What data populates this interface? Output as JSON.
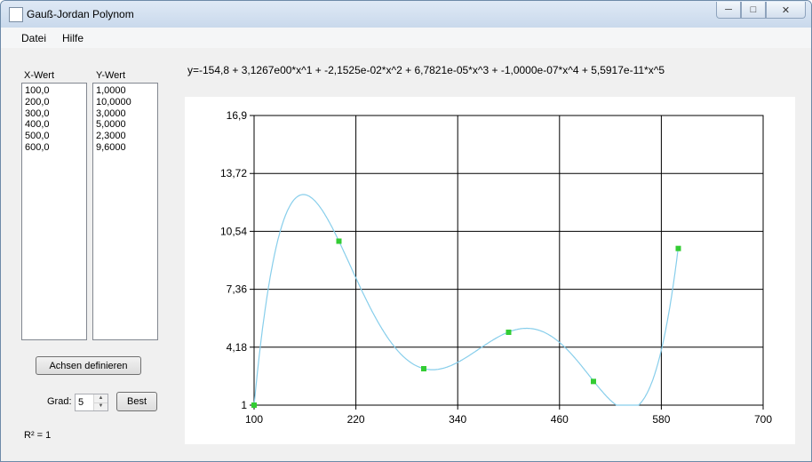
{
  "window": {
    "title": "Gauß-Jordan Polynom"
  },
  "menu": {
    "items": [
      "Datei",
      "Hilfe"
    ]
  },
  "lists": {
    "x_header": "X-Wert",
    "y_header": "Y-Wert",
    "x_values": [
      "100,0",
      "200,0",
      "300,0",
      "400,0",
      "500,0",
      "600,0"
    ],
    "y_values": [
      "1,0000",
      "10,0000",
      "3,0000",
      "5,0000",
      "2,3000",
      "9,6000"
    ]
  },
  "controls": {
    "axes_button": "Achsen definieren",
    "grad_label": "Grad:",
    "grad_value": "5",
    "best_button": "Best",
    "r2_label": "R² = 1"
  },
  "equation": "y=-154,8 + 3,1267e00*x^1 + -2,1525e-02*x^2 + 6,7821e-05*x^3 + -1,0000e-07*x^4 + 5,5917e-11*x^5",
  "chart_data": {
    "type": "scatter",
    "x_ticks": [
      "100",
      "220",
      "340",
      "460",
      "580",
      "700"
    ],
    "y_ticks": [
      "1",
      "4,18",
      "7,36",
      "10,54",
      "13,72",
      "16,9"
    ],
    "xlim": [
      100,
      700
    ],
    "ylim": [
      1,
      16.9
    ],
    "grid": true,
    "points": [
      {
        "x": 100,
        "y": 1.0
      },
      {
        "x": 200,
        "y": 10.0
      },
      {
        "x": 300,
        "y": 3.0
      },
      {
        "x": 400,
        "y": 5.0
      },
      {
        "x": 500,
        "y": 2.3
      },
      {
        "x": 600,
        "y": 9.6
      }
    ],
    "curve": {
      "coefficients": [
        -154.8,
        3.1267,
        -0.021525,
        6.7821e-05,
        -1e-07,
        5.5917e-11
      ],
      "x_range": [
        100,
        600
      ]
    },
    "colors": {
      "points": "#33cc33",
      "curve": "#87ceeb",
      "grid": "#000000"
    }
  }
}
